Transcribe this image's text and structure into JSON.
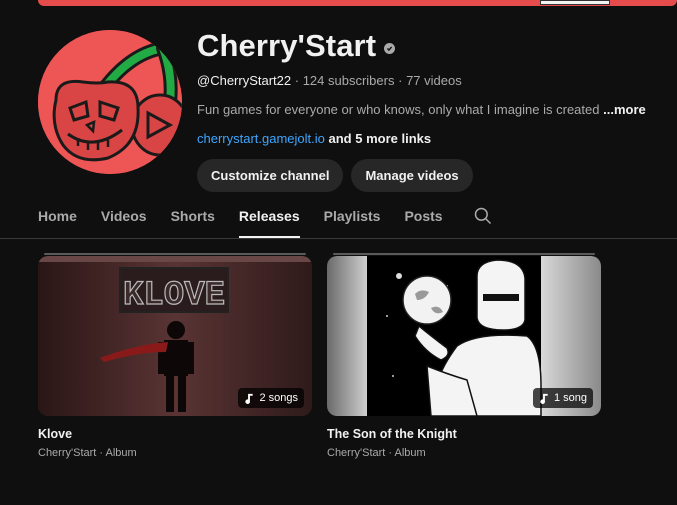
{
  "channel": {
    "name": "Cherry'Start",
    "handle": "@CherryStart22",
    "subscribers": "124 subscribers",
    "videos": "77 videos",
    "description": "Fun games for everyone or who knows, only what I imagine is created",
    "more_label": "...more",
    "link": "cherrystart.gamejolt.io",
    "more_links": "and 5 more links"
  },
  "buttons": {
    "customize": "Customize channel",
    "manage": "Manage videos"
  },
  "tabs": [
    {
      "label": "Home"
    },
    {
      "label": "Videos"
    },
    {
      "label": "Shorts"
    },
    {
      "label": "Releases",
      "active": true
    },
    {
      "label": "Playlists"
    },
    {
      "label": "Posts"
    }
  ],
  "releases": [
    {
      "title": "Klove",
      "sub": "Cherry'Start · Album",
      "songs": "2 songs",
      "thumb_text": "KLOVE"
    },
    {
      "title": "The Son of the Knight",
      "sub": "Cherry'Start · Album",
      "songs": "1 song"
    }
  ],
  "icons": {
    "verified": "verified-icon",
    "search": "search-icon",
    "music_note": "music-note-icon"
  },
  "colors": {
    "background": "#0f0f0f",
    "avatar": "#ee5555",
    "link": "#3ea6ff",
    "button": "#272727"
  }
}
